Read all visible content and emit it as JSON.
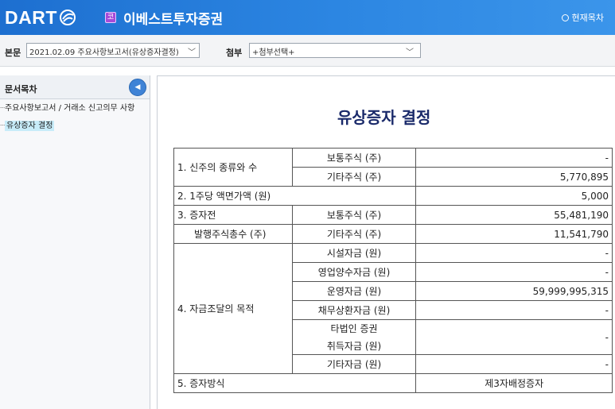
{
  "header": {
    "logo": "DART",
    "company_badge": "코",
    "company_name": "이베스트투자증권",
    "toc_link": "현재목차"
  },
  "toolbar": {
    "main_label": "본문",
    "main_select": "2021.02.09  주요사항보고서(유상증자결정)",
    "attach_label": "첨부",
    "attach_select": "+첨부선택+"
  },
  "sidebar": {
    "title": "문서목차",
    "items": [
      {
        "label": "주요사항보고서 / 거래소 신고의무 사항"
      },
      {
        "label": "유상증자 결정"
      }
    ]
  },
  "document": {
    "title": "유상증자 결정",
    "rows": {
      "r1": {
        "label": "1. 신주의 종류와 수",
        "sub": [
          {
            "label": "보통주식 (주)",
            "value": "-"
          },
          {
            "label": "기타주식 (주)",
            "value": "5,770,895"
          }
        ]
      },
      "r2": {
        "label": "2. 1주당 액면가액 (원)",
        "value": "5,000"
      },
      "r3": {
        "label_line1": "3. 증자전",
        "label_line2": "발행주식총수 (주)",
        "sub": [
          {
            "label": "보통주식 (주)",
            "value": "55,481,190"
          },
          {
            "label": "기타주식 (주)",
            "value": "11,541,790"
          }
        ]
      },
      "r4": {
        "label": "4. 자금조달의 목적",
        "sub": [
          {
            "label": "시설자금 (원)",
            "value": "-"
          },
          {
            "label": "영업양수자금 (원)",
            "value": "-"
          },
          {
            "label": "운영자금 (원)",
            "value": "59,999,995,315"
          },
          {
            "label": "채무상환자금 (원)",
            "value": "-"
          },
          {
            "label_line1": "타법인 증권",
            "label_line2": "취득자금 (원)",
            "value": "-"
          },
          {
            "label": "기타자금 (원)",
            "value": "-"
          }
        ]
      },
      "r5": {
        "label": "5. 증자방식",
        "value": "제3자배정증자"
      }
    }
  }
}
